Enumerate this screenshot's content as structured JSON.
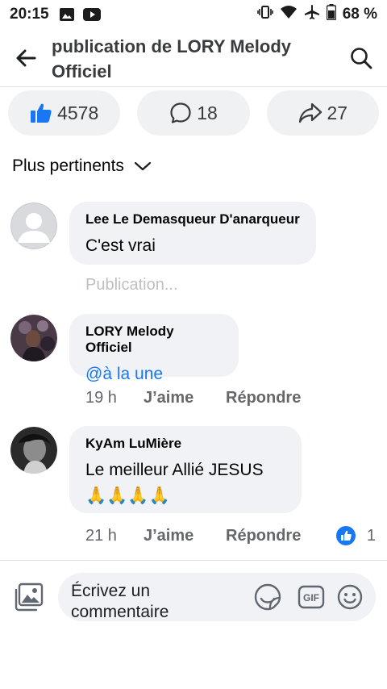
{
  "status_bar": {
    "time": "20:15",
    "battery": "68 %"
  },
  "header": {
    "title": "publication de LORY Melody Officiel"
  },
  "reactions": {
    "likes": "4578",
    "comments": "18",
    "shares": "27"
  },
  "sort": {
    "label": "Plus pertinents"
  },
  "comments": [
    {
      "author": "Lee Le Demasqueur D'anarqueur",
      "text": "C'est vrai",
      "status": "Publication..."
    },
    {
      "author": "LORY Melody Officiel",
      "text": "@à la une",
      "time": "19 h",
      "like": "J’aime",
      "reply": "Répondre"
    },
    {
      "author": "KyAm LuMière",
      "text": "Le meilleur Allié JESUS",
      "emoji": "🙏🙏🙏🙏",
      "time": "21 h",
      "like": "J’aime",
      "reply": "Répondre",
      "like_count": "1"
    }
  ],
  "composer": {
    "placeholder": "Écrivez un commentaire",
    "gif_label": "GIF"
  },
  "colors": {
    "accent": "#1877f2",
    "bubble": "#f0f2f5",
    "muted": "#65676b"
  }
}
